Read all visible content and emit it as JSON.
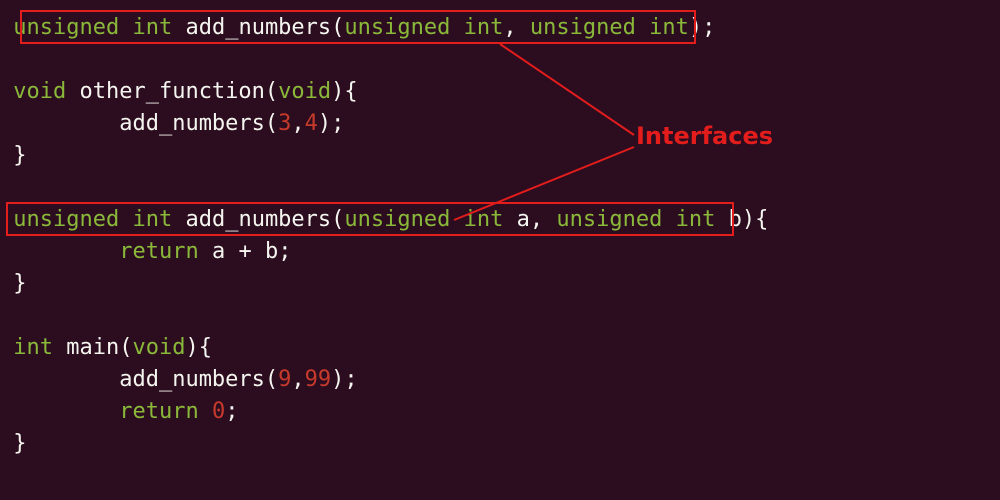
{
  "code": {
    "line1": {
      "t_unsigned": "unsigned",
      "t_int": "int",
      "fn": "add_numbers",
      "p1_unsigned": "unsigned",
      "p1_int": "int",
      "comma": ",",
      "p2_unsigned": "unsigned",
      "p2_int": "int",
      "end": ");"
    },
    "line3": {
      "t_void": "void",
      "fn": "other_function",
      "p_void": "void",
      "brace": "){"
    },
    "line4": {
      "indent": "        ",
      "fn": "add_numbers",
      "open": "(",
      "n1": "3",
      "comma": ",",
      "n2": "4",
      "close": ");"
    },
    "line5": {
      "brace": "}"
    },
    "line7": {
      "t_unsigned": "unsigned",
      "t_int": "int",
      "fn": "add_numbers",
      "open": "(",
      "p1_unsigned": "unsigned",
      "p1_int": "int",
      "p1_name": "a",
      "comma": ",",
      "p2_unsigned": "unsigned",
      "p2_int": "int",
      "p2_name": "b",
      "close": "){"
    },
    "line8": {
      "indent": "        ",
      "kw_return": "return",
      "expr_a": "a",
      "op": "+",
      "expr_b": "b",
      "end": ";"
    },
    "line9": {
      "brace": "}"
    },
    "line11": {
      "t_int": "int",
      "fn": "main",
      "p_void": "void",
      "brace": "){"
    },
    "line12": {
      "indent": "        ",
      "fn": "add_numbers",
      "open": "(",
      "n1": "9",
      "comma": ",",
      "n2": "99",
      "close": ");"
    },
    "line13": {
      "indent": "        ",
      "kw_return": "return",
      "val": "0",
      "end": ";"
    },
    "line14": {
      "brace": "}"
    }
  },
  "annotation": {
    "label": "Interfaces"
  },
  "colors": {
    "background": "#2c0d1f",
    "keyword": "#8ab93a",
    "identifier": "#f5f5f0",
    "number": "#c63a2b",
    "highlight": "#e31c1c"
  }
}
